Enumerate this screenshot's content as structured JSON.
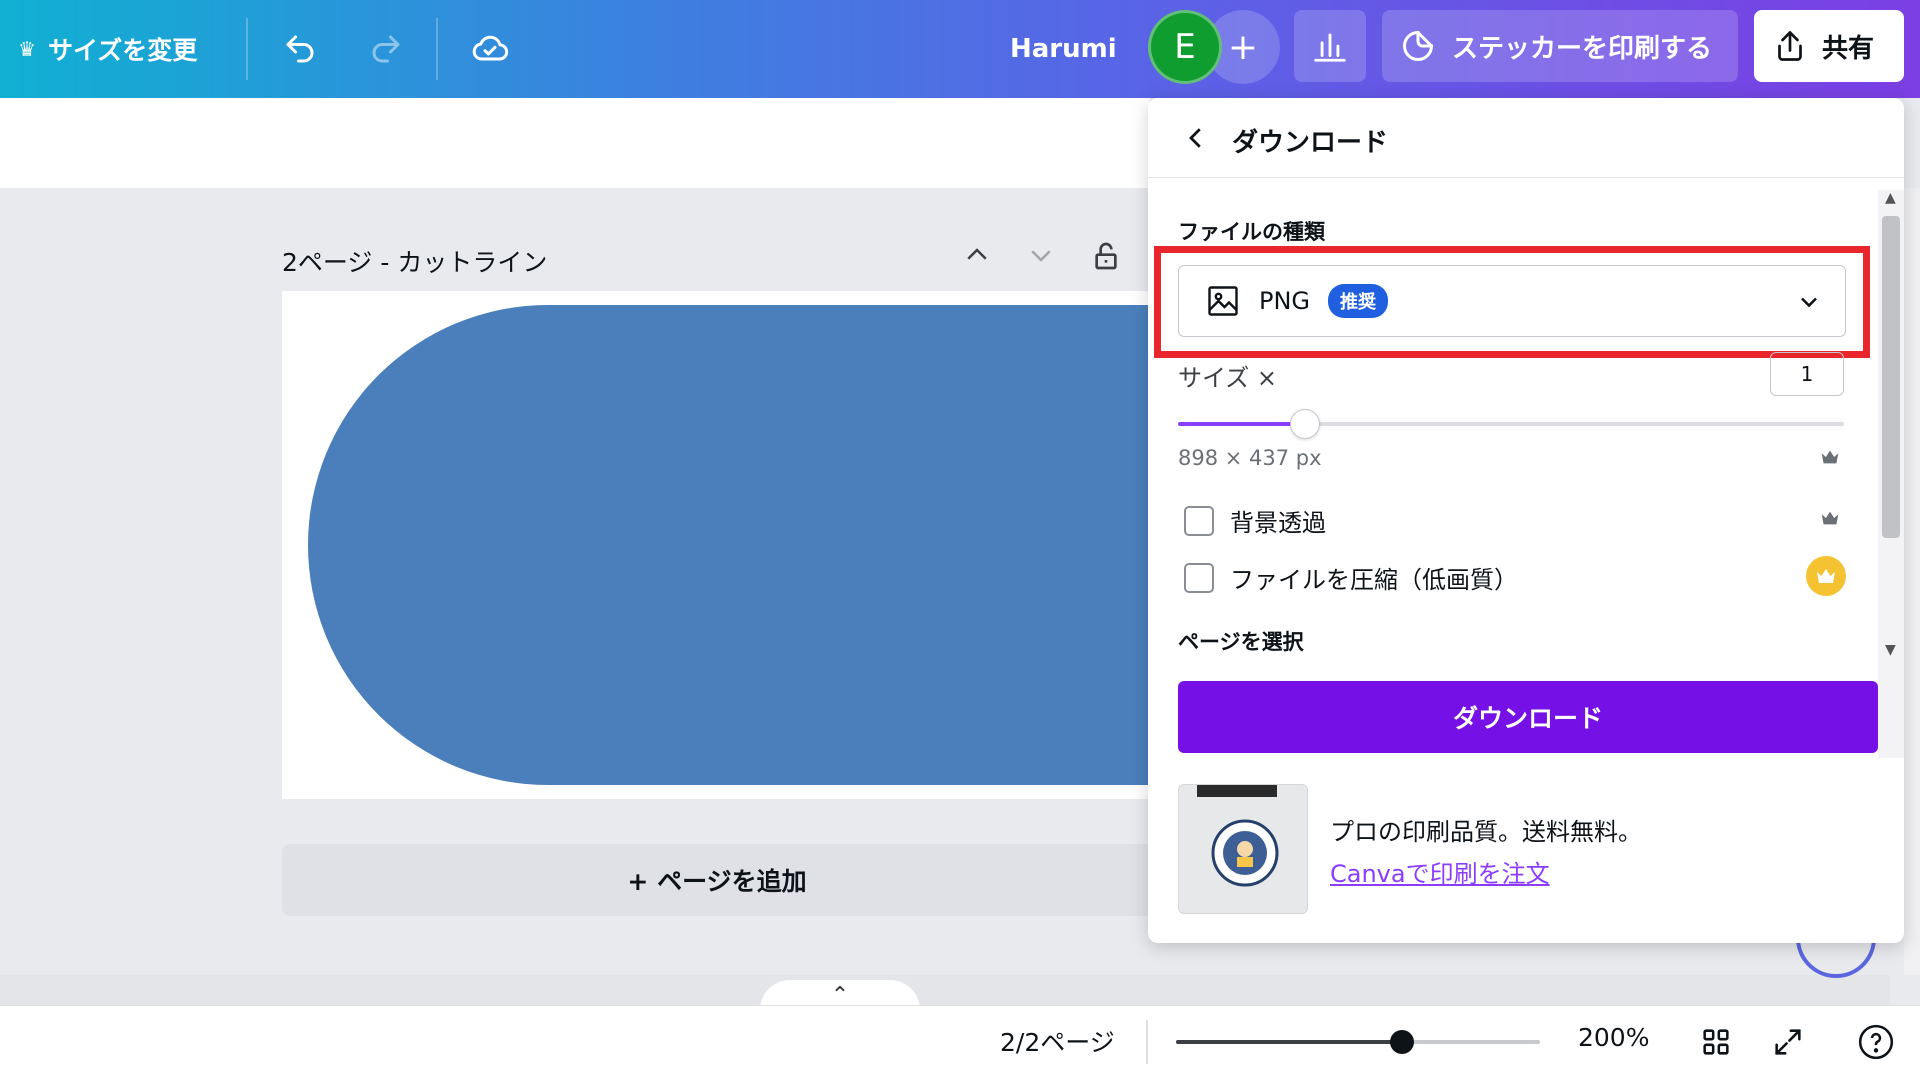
{
  "topbar": {
    "resize_label": "サイズを変更",
    "username": "Harumi",
    "avatar_initial": "E",
    "sticker_label": "ステッカーを印刷する",
    "share_label": "共有"
  },
  "canvas": {
    "page_title": "2ページ - カットライン",
    "add_page_label": "+ ページを追加",
    "shape_color": "#4a7fbb"
  },
  "bottombar": {
    "page_info": "2/2ページ",
    "zoom_label": "200%",
    "zoom_level": 0.62
  },
  "download_panel": {
    "title": "ダウンロード",
    "file_type_label": "ファイルの種類",
    "file_type_value": "PNG",
    "recommended_badge": "推奨",
    "size_label": "サイズ ×",
    "size_value": "1",
    "size_level": 0.19,
    "dimensions": "898 × 437 px",
    "transparent_bg_label": "背景透過",
    "compress_label": "ファイルを圧縮（低画質）",
    "select_pages_label": "ページを選択",
    "download_button": "ダウンロード",
    "promo_text": "プロの印刷品質。送料無料。",
    "promo_link": "Canvaで印刷を注文"
  },
  "colors": {
    "accent_purple": "#7510e6",
    "highlight_red": "#e8262c",
    "badge_blue": "#1f5fe0",
    "avatar_green": "#0f9d2f"
  }
}
